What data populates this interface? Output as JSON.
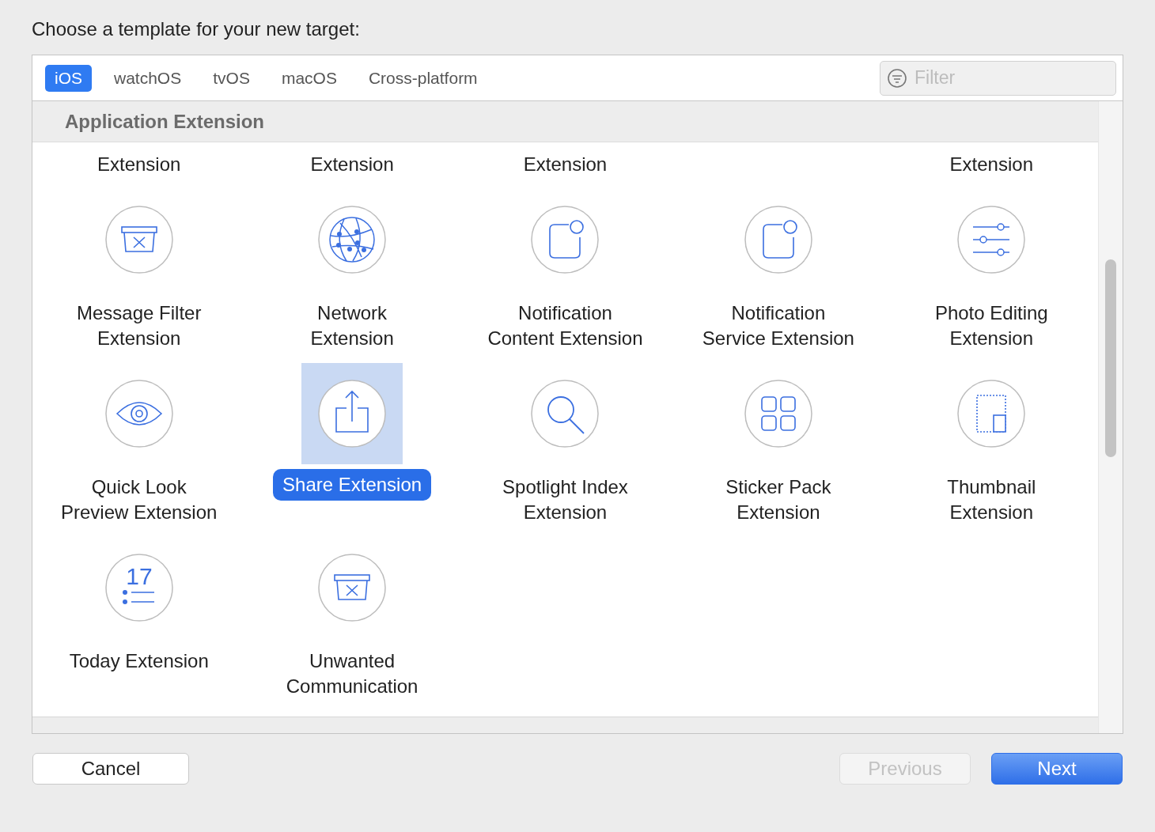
{
  "title": "Choose a template for your new target:",
  "tabs": [
    {
      "label": "iOS",
      "selected": true
    },
    {
      "label": "watchOS",
      "selected": false
    },
    {
      "label": "tvOS",
      "selected": false
    },
    {
      "label": "macOS",
      "selected": false
    },
    {
      "label": "Cross-platform",
      "selected": false
    }
  ],
  "filter": {
    "placeholder": "Filter"
  },
  "section": {
    "title": "Application Extension"
  },
  "top_row": [
    "Extension",
    "Extension",
    "Extension",
    "Extension"
  ],
  "templates": [
    {
      "label": "Message Filter\nExtension",
      "selected": false
    },
    {
      "label": "Network\nExtension",
      "selected": false
    },
    {
      "label": "Notification\nContent Extension",
      "selected": false
    },
    {
      "label": "Notification\nService Extension",
      "selected": false
    },
    {
      "label": "Photo Editing\nExtension",
      "selected": false
    },
    {
      "label": "Quick Look\nPreview Extension",
      "selected": false
    },
    {
      "label": "Share Extension",
      "selected": true
    },
    {
      "label": "Spotlight Index\nExtension",
      "selected": false
    },
    {
      "label": "Sticker Pack\nExtension",
      "selected": false
    },
    {
      "label": "Thumbnail\nExtension",
      "selected": false
    },
    {
      "label": "Today Extension",
      "selected": false,
      "icon_text": "17"
    },
    {
      "label": "Unwanted\nCommunication",
      "selected": false
    }
  ],
  "buttons": [
    {
      "label": "Cancel",
      "kind": "normal",
      "disabled": false
    },
    {
      "label": "Previous",
      "kind": "normal",
      "disabled": true
    },
    {
      "label": "Next",
      "kind": "default",
      "disabled": false
    }
  ]
}
